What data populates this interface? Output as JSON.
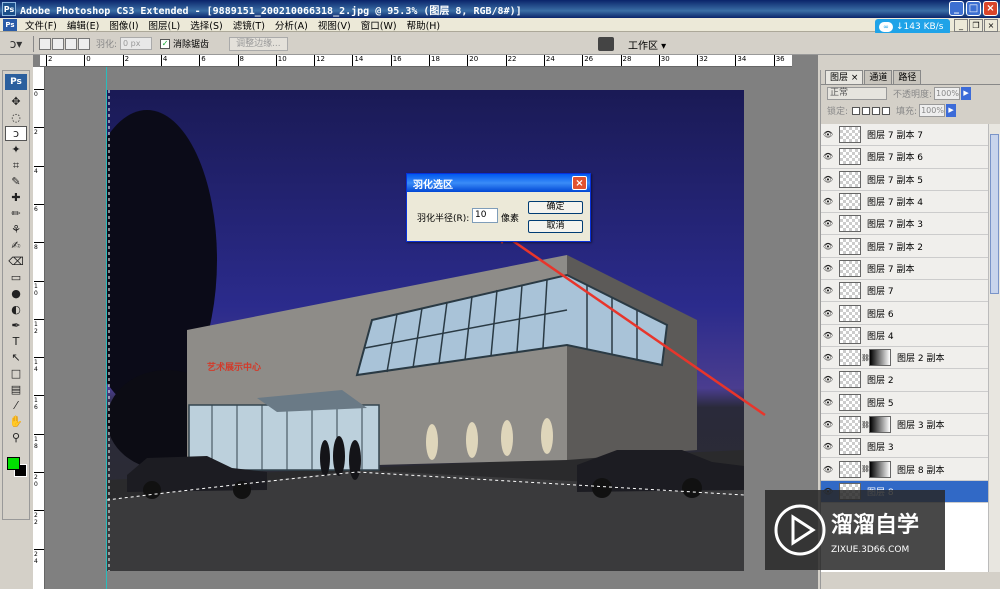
{
  "window": {
    "app_icon": "Ps",
    "title": "Adobe Photoshop CS3 Extended - [9889151_200210066318_2.jpg @ 95.3% (图层 8, RGB/8#)]",
    "buttons": [
      "_",
      "□",
      "×"
    ]
  },
  "menubar": {
    "items": [
      "文件(F)",
      "编辑(E)",
      "图像(I)",
      "图层(L)",
      "选择(S)",
      "滤镜(T)",
      "分析(A)",
      "视图(V)",
      "窗口(W)",
      "帮助(H)"
    ]
  },
  "speed_widget": {
    "text": "↓143 KB/s"
  },
  "optionsbar": {
    "feather_label": "羽化:",
    "feather_value": "0 px",
    "antialias_label": "消除锯齿",
    "antialias_checked": true,
    "refine_edge_label": "调整边缘...",
    "workspace_label": "工作区 ▾"
  },
  "toolbox": {
    "logo": "Ps",
    "tools": [
      "move-tool-icon",
      "marquee-tool-icon",
      "lasso-tool-icon",
      "magic-wand-icon",
      "crop-tool-icon",
      "eyedropper-icon",
      "healing-brush-icon",
      "brush-tool-icon",
      "clone-stamp-icon",
      "history-brush-icon",
      "eraser-icon",
      "gradient-tool-icon",
      "blur-tool-icon",
      "dodge-tool-icon",
      "pen-tool-icon",
      "type-tool-icon",
      "path-select-icon",
      "shape-tool-icon",
      "notes-tool-icon",
      "eyedropper2-icon",
      "hand-tool-icon",
      "zoom-tool-icon"
    ],
    "glyphs": [
      "✥",
      "◌",
      "ↄ",
      "✦",
      "⌗",
      "✎",
      "✚",
      "✏",
      "⚘",
      "✍",
      "⌫",
      "▭",
      "●",
      "◐",
      "✒",
      "T",
      "↖",
      "□",
      "▤",
      "⁄",
      "✋",
      "⚲"
    ],
    "foreground_color": "#00e000",
    "background_color": "#000000"
  },
  "ruler": {
    "h_ticks": [
      "2",
      "0",
      "2",
      "4",
      "6",
      "8",
      "10",
      "12",
      "14",
      "16",
      "18",
      "20",
      "22",
      "24",
      "26",
      "28",
      "30",
      "32",
      "34",
      "36"
    ],
    "v_ticks": [
      "0",
      "2",
      "4",
      "6",
      "8",
      "1\n0",
      "1\n2",
      "1\n4",
      "1\n6",
      "1\n8",
      "2\n0",
      "2\n2",
      "2\n4"
    ]
  },
  "dialog": {
    "title": "羽化选区",
    "radius_label": "羽化半径(R):",
    "radius_value": "10",
    "unit": "像素",
    "ok_label": "确定",
    "cancel_label": "取消"
  },
  "canvas": {
    "building_sign": "艺术展示中心",
    "annotation_color": "#e8352b"
  },
  "panel": {
    "tabs": [
      "图层 ×",
      "通道",
      "路径"
    ],
    "blend_mode": "正常",
    "opacity_label": "不透明度:",
    "opacity_value": "100%",
    "lock_label": "锁定:",
    "fill_label": "填充:",
    "fill_value": "100%",
    "layers": [
      {
        "name": "图层 7 副本 7",
        "mask": false
      },
      {
        "name": "图层 7 副本 6",
        "mask": false
      },
      {
        "name": "图层 7 副本 5",
        "mask": false
      },
      {
        "name": "图层 7 副本 4",
        "mask": false
      },
      {
        "name": "图层 7 副本 3",
        "mask": false
      },
      {
        "name": "图层 7 副本 2",
        "mask": false
      },
      {
        "name": "图层 7 副本",
        "mask": false
      },
      {
        "name": "图层 7",
        "mask": false
      },
      {
        "name": "图层 6",
        "mask": false
      },
      {
        "name": "图层 4",
        "mask": false
      },
      {
        "name": "图层 2 副本",
        "mask": true
      },
      {
        "name": "图层 2",
        "mask": false
      },
      {
        "name": "图层 5",
        "mask": false
      },
      {
        "name": "图层 3 副本",
        "mask": true
      },
      {
        "name": "图层 3",
        "mask": false
      },
      {
        "name": "图层 8 副本",
        "mask": true
      },
      {
        "name": "图层 8",
        "mask": false,
        "selected": true
      }
    ]
  },
  "watermark": {
    "brand": "溜溜自学",
    "url": "ZIXUE.3D66.COM"
  }
}
